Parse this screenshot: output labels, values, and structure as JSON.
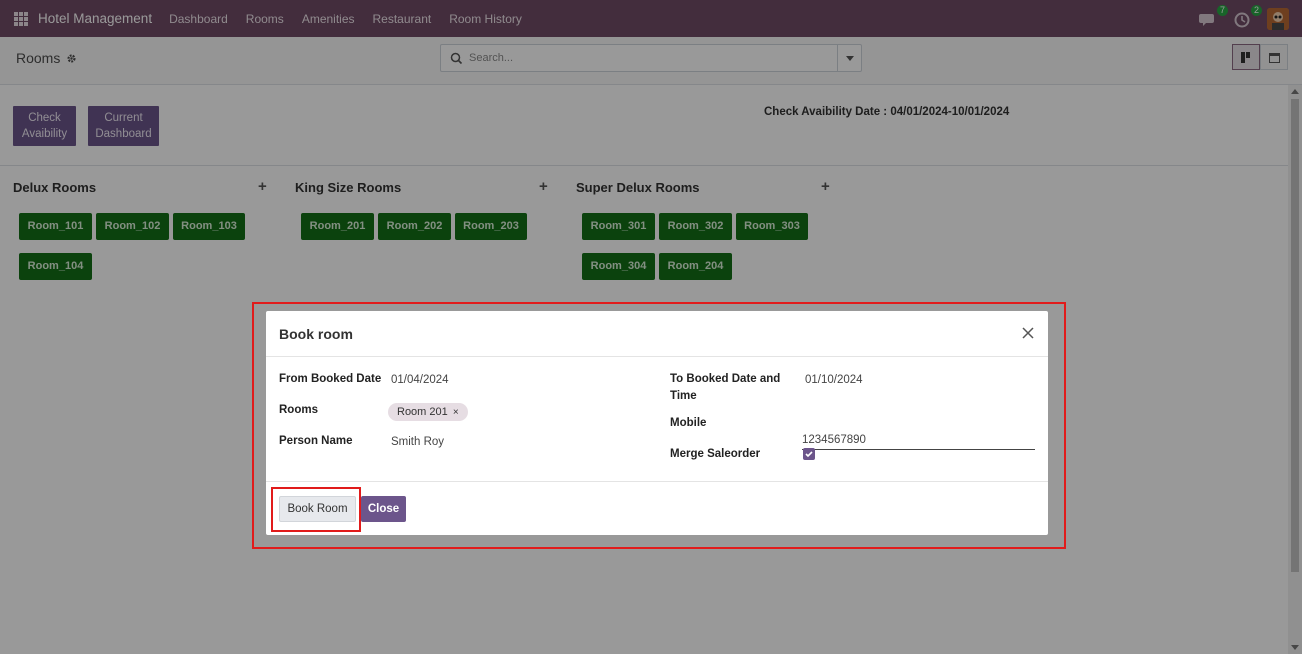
{
  "navbar": {
    "brand": "Hotel Management",
    "menu": [
      "Dashboard",
      "Rooms",
      "Amenities",
      "Restaurant",
      "Room History"
    ],
    "chat_count": "7",
    "activity_count": "2"
  },
  "control": {
    "title": "Rooms",
    "search_placeholder": "Search..."
  },
  "actions": {
    "check_availability": "Check Avaibility",
    "current_dashboard": "Current Dashboard"
  },
  "availability_text": "Check Avaibility Date : 04/01/2024-10/01/2024",
  "columns": [
    {
      "title": "Delux Rooms",
      "rooms": [
        "Room_101",
        "Room_102",
        "Room_103",
        "Room_104"
      ]
    },
    {
      "title": "King Size Rooms",
      "rooms": [
        "Room_201",
        "Room_202",
        "Room_203"
      ]
    },
    {
      "title": "Super Delux Rooms",
      "rooms": [
        "Room_301",
        "Room_302",
        "Room_303",
        "Room_304",
        "Room_204"
      ]
    }
  ],
  "modal": {
    "title": "Book room",
    "from_label": "From Booked Date",
    "from_value": "01/04/2024",
    "rooms_label": "Rooms",
    "room_tag": "Room  201",
    "person_label": "Person Name",
    "person_value": "Smith Roy",
    "to_label": "To Booked Date and Time",
    "to_value": "01/10/2024",
    "mobile_label": "Mobile",
    "mobile_value": "1234567890",
    "merge_label": "Merge Saleorder",
    "merge_checked": true,
    "book_button": "Book Room",
    "close_button": "Close"
  },
  "colors": {
    "navbar": "#714b67",
    "room_green": "#136e17",
    "action_purple": "#6c558b",
    "highlight": "#e11b1b"
  }
}
